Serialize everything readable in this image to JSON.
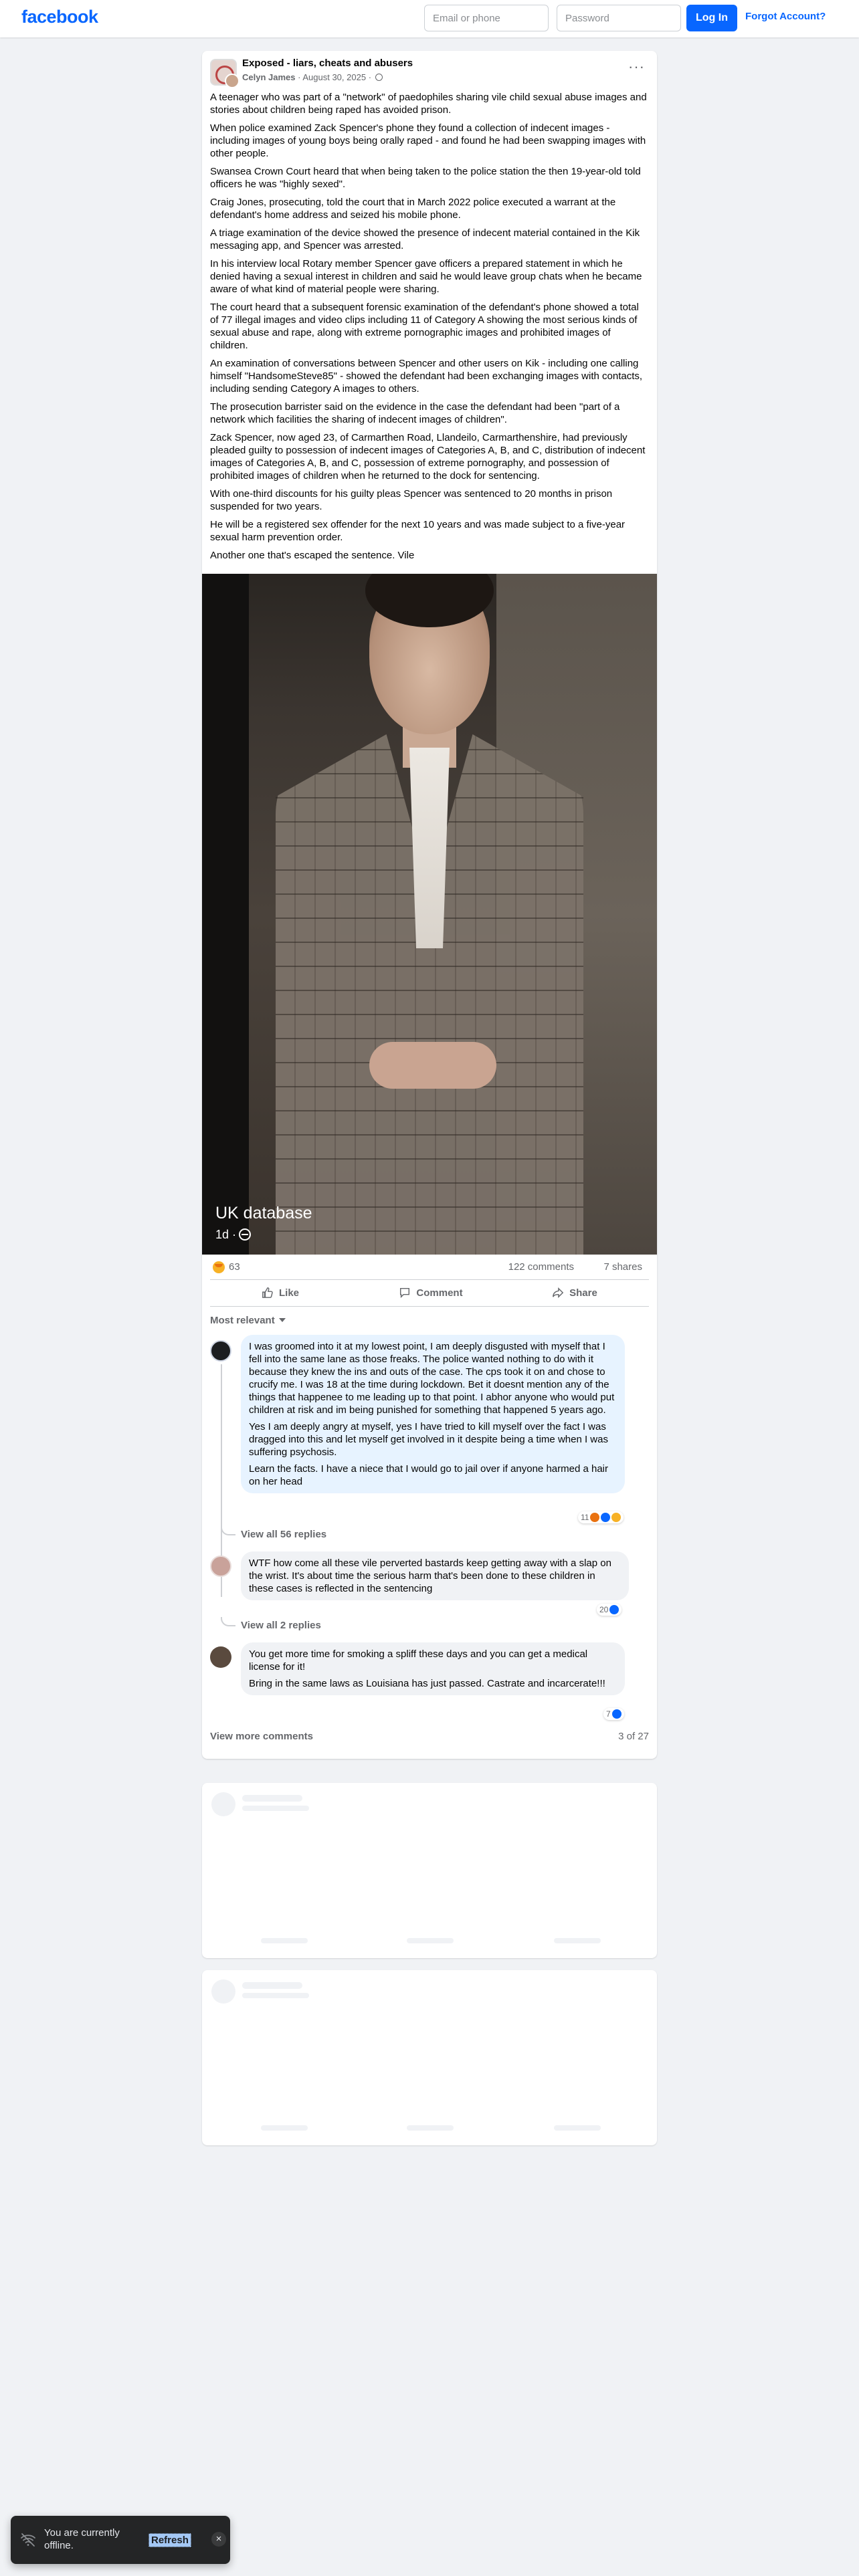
{
  "header": {
    "logo": "facebook",
    "email_placeholder": "Email or phone",
    "password_placeholder": "Password",
    "login_label": "Log In",
    "forgot_label": "Forgot Account?"
  },
  "post": {
    "group_name": "Exposed - liars, cheats and abusers",
    "author": "Celyn James",
    "date": "August 30, 2025",
    "paragraphs": [
      "A teenager who was part of a \"network\" of paedophiles sharing vile child sexual abuse images and stories about children being raped has avoided prison.",
      "When police examined Zack Spencer's phone they found a collection of indecent images - including images of young boys being orally raped - and found he had been swapping images with other people.",
      "Swansea Crown Court heard that when being taken to the police station the then 19-year-old told officers he was \"highly sexed\".",
      "Craig Jones, prosecuting, told the court that in March 2022 police executed a warrant at the defendant's home address and seized his mobile phone.",
      "A triage examination of the device showed the presence of indecent material contained in the Kik messaging app, and Spencer was arrested.",
      "In his interview local Rotary member Spencer gave officers a prepared statement in which he denied having a sexual interest in children and said he would leave group chats when he became aware of what kind of material people were sharing.",
      "The court heard that a subsequent forensic examination of the defendant's phone showed a total of 77 illegal images and video clips including 11 of Category A showing the most serious kinds of sexual abuse and rape, along with extreme pornographic images and prohibited images of children.",
      "An examination of conversations between Spencer and other users on Kik - including one calling himself \"HandsomeSteve85\" - showed the defendant had been exchanging images with contacts, including sending Category A images to others.",
      "The prosecution barrister said on the evidence in the case the defendant had been \"part of a network which facilities the sharing of indecent images of children\".",
      "Zack Spencer, now aged 23, of Carmarthen Road, Llandeilo, Carmarthenshire, had previously pleaded guilty to possession of indecent images of Categories A, B, and C, distribution of indecent images of Categories A, B, and C, possession of extreme pornography, and possession of prohibited images of children when he returned to the dock for sentencing.",
      "With one-third discounts for his guilty pleas Spencer was sentenced to 20 months in prison suspended for two years.",
      "He will be a registered sex offender for the next 10 years and was made subject to a five-year sexual harm prevention order.",
      "Another one that's escaped the sentence. Vile"
    ],
    "image_caption": {
      "title": "UK database",
      "age": "1d ·"
    },
    "reactions_count": "63",
    "comments_count": "122 comments",
    "shares_count": "7 shares",
    "actions": {
      "like": "Like",
      "comment": "Comment",
      "share": "Share"
    },
    "sort_label": "Most relevant"
  },
  "comments": [
    {
      "paragraphs": [
        "I was groomed into it at my lowest point, I am deeply disgusted with myself that I fell into the same lane as those freaks. The police wanted nothing to do with it because they knew the ins and outs of the case. The cps took it on and chose to crucify me. I was 18 at the time during lockdown. Bet it doesnt mention any of the things that happenee to me leading up to that point. I abhor anyone who would put children at risk and im being punished for something that happened 5 years ago.",
        "Yes I am deeply angry at myself, yes I have tried to kill myself over the fact I was dragged into this and let myself get involved in it despite being a time when I was suffering psychosis.",
        "Learn the facts. I have a niece that I would go to jail over if anyone harmed a hair on her head"
      ],
      "reactions": "11",
      "view_replies": "View all 56 replies"
    },
    {
      "paragraphs": [
        "WTF how come all these vile perverted bastards keep getting away with a slap on the wrist. It's about time the serious harm that's been done to these children in these cases is reflected in the sentencing"
      ],
      "reactions": "20",
      "view_replies": "View all 2 replies"
    },
    {
      "paragraphs": [
        "You get more time for smoking a spliff these days and you can get a medical license for it!",
        "Bring in the same laws as Louisiana has just passed. Castrate and incarcerate!!!"
      ],
      "reactions": "7"
    }
  ],
  "comments_footer": {
    "view_more": "View more comments",
    "page_of": "3 of 27"
  },
  "toast": {
    "message": "You are currently offline.",
    "refresh_label": "Refresh",
    "close_label": "×"
  },
  "colors": {
    "brand": "#0866ff",
    "page_bg": "#f0f2f5",
    "highlight_comment_bg": "#e7f3ff"
  }
}
